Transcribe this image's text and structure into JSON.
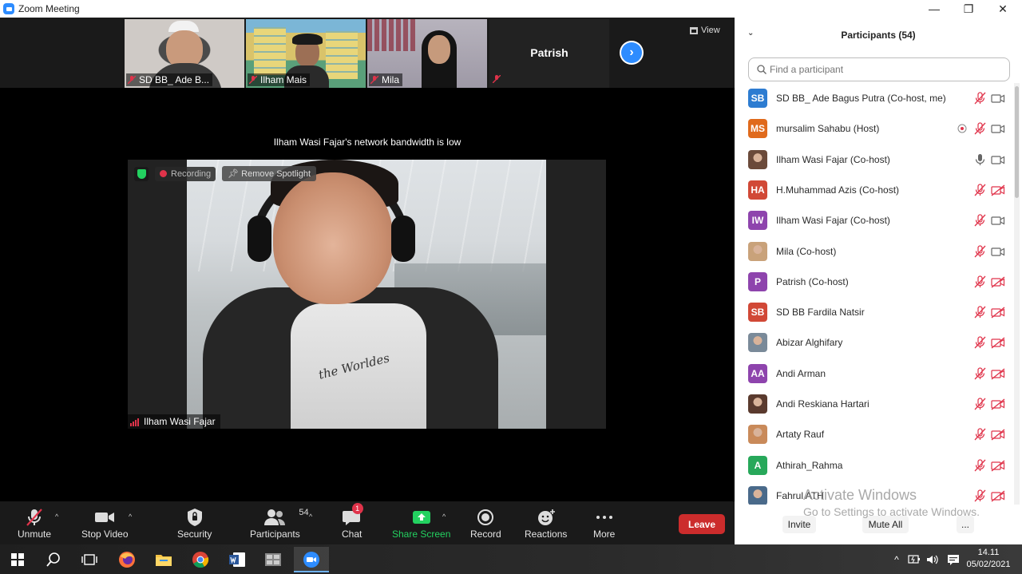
{
  "window": {
    "title": "Zoom Meeting",
    "minimize_glyph": "—",
    "restore_glyph": "❐",
    "close_glyph": "✕"
  },
  "gallery": {
    "thumbnails": [
      {
        "name": "SD BB_ Ade B...",
        "muted": true
      },
      {
        "name": "Ilham Mais",
        "muted": true
      },
      {
        "name": "Mila",
        "muted": true
      }
    ],
    "name_only_tile": {
      "name": "Patrish",
      "muted": true
    },
    "next_page_icon": "chevron-right-icon",
    "view_label": "View"
  },
  "stage": {
    "notice": "Ilham Wasi Fajar's network bandwidth is low",
    "recording_label": "Recording",
    "remove_spotlight_label": "Remove Spotlight",
    "speaker_name": "Ilham Wasi Fajar",
    "shirt_text": "the Worldes"
  },
  "toolbar": {
    "unmute": "Unmute",
    "stop_video": "Stop Video",
    "security": "Security",
    "participants": "Participants",
    "participants_count": "54",
    "chat": "Chat",
    "chat_badge": "1",
    "share_screen": "Share Screen",
    "record": "Record",
    "reactions": "Reactions",
    "more": "More",
    "leave": "Leave",
    "caret": "^",
    "colors": {
      "leave": "#cc2c2c",
      "share": "#23d160",
      "badge": "#e0334a"
    }
  },
  "participants_panel": {
    "title": "Participants (54)",
    "collapse_glyph": "⌄",
    "search_placeholder": "Find a participant",
    "participants": [
      {
        "initials": "SB",
        "color": "#2d7cd1",
        "name": "SD BB_ Ade Bagus Putra (Co-host, me)",
        "mic": "muted",
        "video": "on",
        "extra": ""
      },
      {
        "initials": "MS",
        "color": "#e06a1c",
        "name": "mursalim Sahabu (Host)",
        "mic": "muted",
        "video": "on",
        "extra": "recording"
      },
      {
        "initials": "",
        "color": "#6b4a3a",
        "name": "Ilham Wasi Fajar (Co-host)",
        "mic": "on",
        "video": "on",
        "extra": "",
        "photo": true
      },
      {
        "initials": "HA",
        "color": "#d14836",
        "name": "H.Muhammad Azis (Co-host)",
        "mic": "muted",
        "video": "off",
        "extra": ""
      },
      {
        "initials": "IW",
        "color": "#8e44ad",
        "name": "Ilham Wasi Fajar (Co-host)",
        "mic": "muted",
        "video": "on",
        "extra": ""
      },
      {
        "initials": "",
        "color": "#c9a27a",
        "name": "Mila (Co-host)",
        "mic": "muted",
        "video": "on",
        "extra": "",
        "photo": true
      },
      {
        "initials": "P",
        "color": "#8e44ad",
        "name": "Patrish (Co-host)",
        "mic": "muted",
        "video": "off",
        "extra": ""
      },
      {
        "initials": "SB",
        "color": "#d14836",
        "name": "SD BB Fardila Natsir",
        "mic": "muted",
        "video": "off",
        "extra": ""
      },
      {
        "initials": "",
        "color": "#7a8a99",
        "name": "Abizar Alghifary",
        "mic": "muted",
        "video": "off",
        "extra": "",
        "photo": true
      },
      {
        "initials": "AA",
        "color": "#8e44ad",
        "name": "Andi Arman",
        "mic": "muted",
        "video": "off",
        "extra": ""
      },
      {
        "initials": "",
        "color": "#5a3a2e",
        "name": "Andi Reskiana Hartari",
        "mic": "muted",
        "video": "off",
        "extra": "",
        "photo": true
      },
      {
        "initials": "",
        "color": "#c98a5a",
        "name": "Artaty Rauf",
        "mic": "muted",
        "video": "off",
        "extra": "",
        "photo": true
      },
      {
        "initials": "A",
        "color": "#27a85a",
        "name": "Athirah_Rahma",
        "mic": "muted",
        "video": "off",
        "extra": ""
      },
      {
        "initials": "",
        "color": "#4a6a8a",
        "name": "Fahrul ATH",
        "mic": "muted",
        "video": "off",
        "extra": "",
        "photo": true
      }
    ],
    "invite": "Invite",
    "mute_all": "Mute All",
    "more": "..."
  },
  "watermark": {
    "line1": "Activate Windows",
    "line2": "Go to Settings to activate Windows."
  },
  "taskbar": {
    "apps": [
      "windows-start-icon",
      "search-icon",
      "task-view-icon",
      "firefox-icon",
      "file-explorer-icon",
      "chrome-icon",
      "word-icon",
      "photos-icon",
      "zoom-icon"
    ],
    "tray_chevron": "^",
    "time": "14.11",
    "date": "05/02/2021"
  }
}
